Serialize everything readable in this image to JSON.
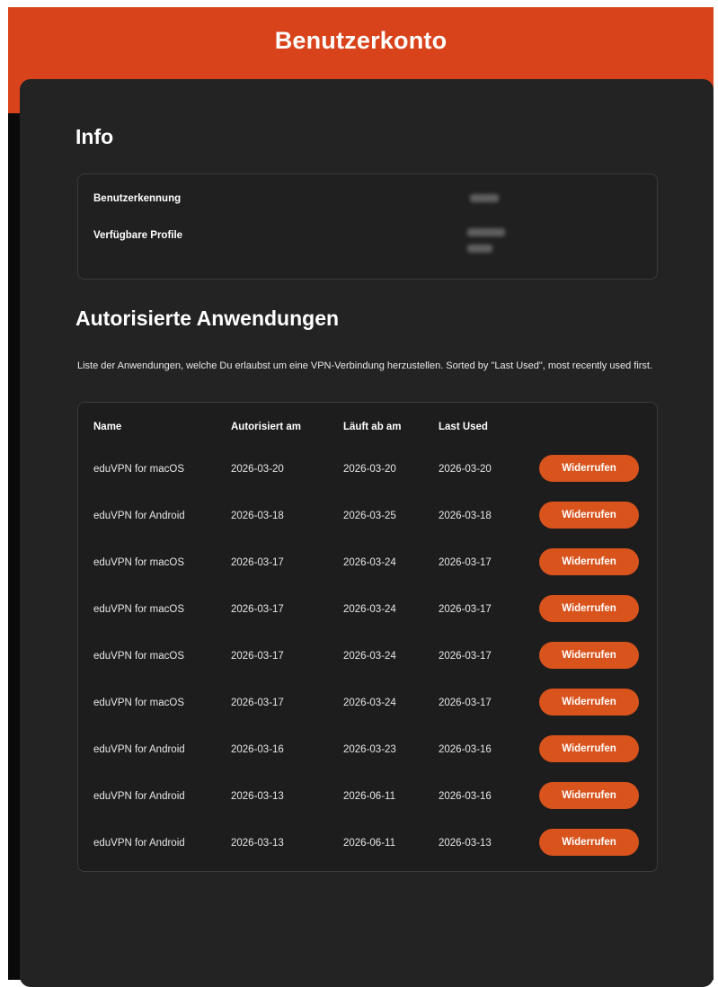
{
  "header": {
    "title": "Benutzerkonto"
  },
  "info": {
    "heading": "Info",
    "user_id_label": "Benutzerkennung",
    "profiles_label": "Verfügbare Profile"
  },
  "apps": {
    "heading": "Autorisierte Anwendungen",
    "description": "Liste der Anwendungen, welche Du erlaubst um eine VPN-Verbindung herzustellen. Sorted by \"Last Used\", most recently used first.",
    "columns": {
      "name": "Name",
      "authorized": "Autorisiert am",
      "expires": "Läuft ab am",
      "last_used": "Last Used"
    },
    "rows": [
      {
        "name": "eduVPN for macOS",
        "authorized": "2026-03-20",
        "expires": "2026-03-20",
        "last_used": "2026-03-20",
        "action": "Widerrufen"
      },
      {
        "name": "eduVPN for Android",
        "authorized": "2026-03-18",
        "expires": "2026-03-25",
        "last_used": "2026-03-18",
        "action": "Widerrufen"
      },
      {
        "name": "eduVPN for macOS",
        "authorized": "2026-03-17",
        "expires": "2026-03-24",
        "last_used": "2026-03-17",
        "action": "Widerrufen"
      },
      {
        "name": "eduVPN for macOS",
        "authorized": "2026-03-17",
        "expires": "2026-03-24",
        "last_used": "2026-03-17",
        "action": "Widerrufen"
      },
      {
        "name": "eduVPN for macOS",
        "authorized": "2026-03-17",
        "expires": "2026-03-24",
        "last_used": "2026-03-17",
        "action": "Widerrufen"
      },
      {
        "name": "eduVPN for macOS",
        "authorized": "2026-03-17",
        "expires": "2026-03-24",
        "last_used": "2026-03-17",
        "action": "Widerrufen"
      },
      {
        "name": "eduVPN for Android",
        "authorized": "2026-03-16",
        "expires": "2026-03-23",
        "last_used": "2026-03-16",
        "action": "Widerrufen"
      },
      {
        "name": "eduVPN for Android",
        "authorized": "2026-03-13",
        "expires": "2026-06-11",
        "last_used": "2026-03-16",
        "action": "Widerrufen"
      },
      {
        "name": "eduVPN for Android",
        "authorized": "2026-03-13",
        "expires": "2026-06-11",
        "last_used": "2026-03-13",
        "action": "Widerrufen"
      }
    ]
  },
  "colors": {
    "accent": "#d9431c",
    "button": "#d9531c",
    "card": "#232323"
  }
}
